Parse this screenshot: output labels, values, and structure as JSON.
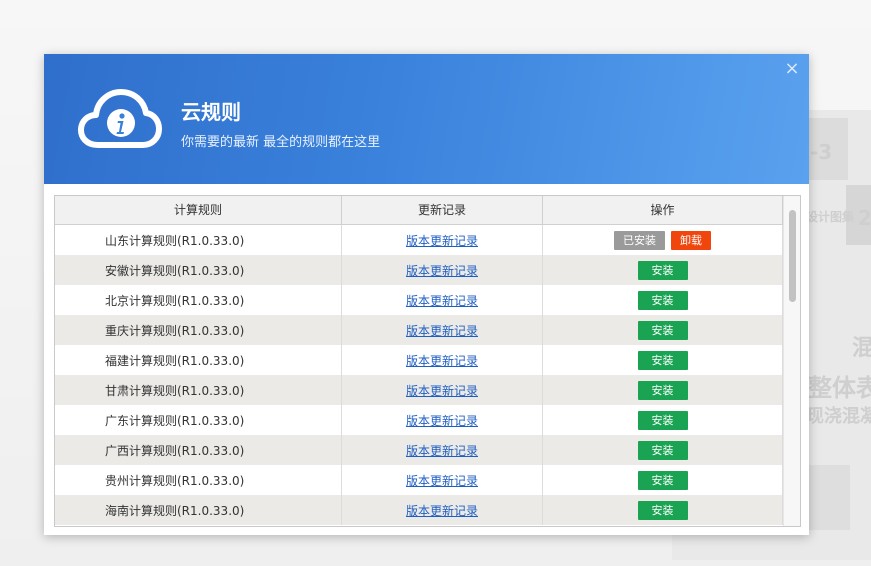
{
  "dialog": {
    "title": "云规则",
    "subtitle": "你需要的最新 最全的规则都在这里",
    "close_label": "×"
  },
  "table": {
    "headers": [
      "计算规则",
      "更新记录",
      "操作"
    ],
    "link_label": "版本更新记录",
    "rows": [
      {
        "name": "山东计算规则(R1.0.33.0)",
        "installed": true
      },
      {
        "name": "安徽计算规则(R1.0.33.0)",
        "installed": false
      },
      {
        "name": "北京计算规则(R1.0.33.0)",
        "installed": false
      },
      {
        "name": "重庆计算规则(R1.0.33.0)",
        "installed": false
      },
      {
        "name": "福建计算规则(R1.0.33.0)",
        "installed": false
      },
      {
        "name": "甘肃计算规则(R1.0.33.0)",
        "installed": false
      },
      {
        "name": "广东计算规则(R1.0.33.0)",
        "installed": false
      },
      {
        "name": "广西计算规则(R1.0.33.0)",
        "installed": false
      },
      {
        "name": "贵州计算规则(R1.0.33.0)",
        "installed": false
      },
      {
        "name": "海南计算规则(R1.0.33.0)",
        "installed": false
      }
    ],
    "installed_label": "已安装",
    "uninstall_label": "卸载",
    "install_label": "安装"
  },
  "background": {
    "fragments": [
      "-3",
      "设计图集",
      "2",
      "混",
      "整体表",
      "现浇混凝"
    ]
  },
  "colors": {
    "header_start": "#2f6fcb",
    "header_end": "#5aa2ef",
    "install_green": "#1ba354",
    "uninstall_red": "#f0460e",
    "installed_gray": "#9a9a9a",
    "link_blue": "#1f5fc3"
  }
}
